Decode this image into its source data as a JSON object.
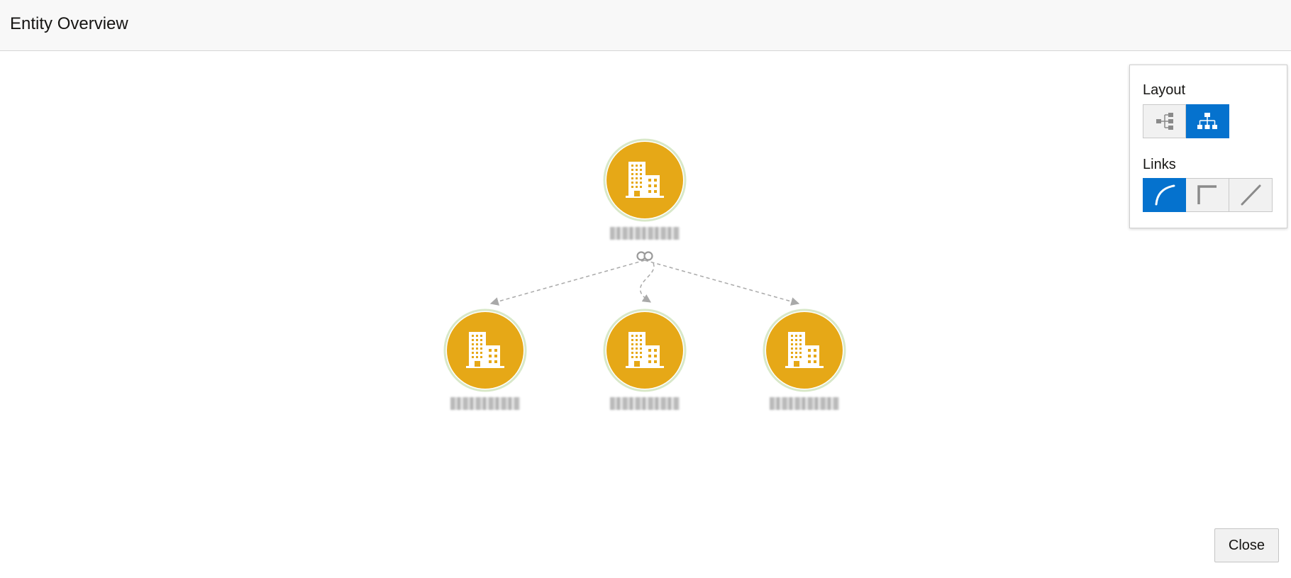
{
  "header": {
    "title": "Entity Overview"
  },
  "graph": {
    "node_color": "#e6a817",
    "link_color": "#a9a9a9",
    "nodes": [
      {
        "id": "root",
        "icon": "building-icon",
        "label": ""
      },
      {
        "id": "child-1",
        "icon": "building-icon",
        "label": ""
      },
      {
        "id": "child-2",
        "icon": "building-icon",
        "label": ""
      },
      {
        "id": "child-3",
        "icon": "building-icon",
        "label": ""
      }
    ],
    "links": [
      {
        "from": "root",
        "to": "child-1"
      },
      {
        "from": "root",
        "to": "child-2"
      },
      {
        "from": "root",
        "to": "child-3"
      }
    ],
    "link_connector_icon": "infinity-icon"
  },
  "panel": {
    "layout_label": "Layout",
    "layout_options": [
      {
        "icon": "horizontal-tree-icon",
        "selected": false
      },
      {
        "icon": "vertical-tree-icon",
        "selected": true
      }
    ],
    "links_label": "Links",
    "links_options": [
      {
        "icon": "curved-link-icon",
        "selected": true
      },
      {
        "icon": "orthogonal-link-icon",
        "selected": false
      },
      {
        "icon": "straight-link-icon",
        "selected": false
      }
    ],
    "accent_color": "#0572ce"
  },
  "footer": {
    "close_label": "Close"
  }
}
